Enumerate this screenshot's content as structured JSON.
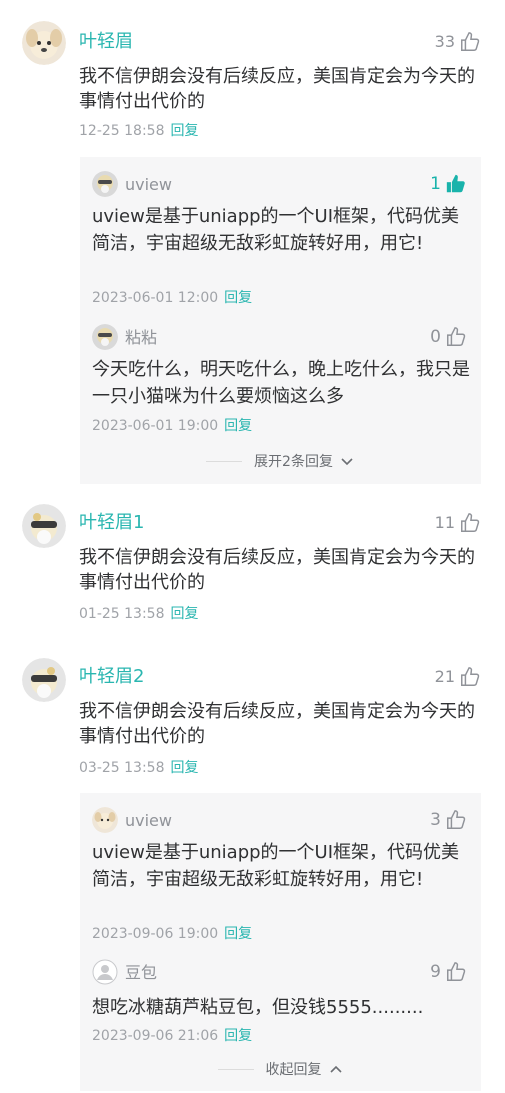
{
  "colors": {
    "accent": "#2ab6b0",
    "liked": "#19b3ab",
    "muted": "#a0a3a8",
    "reply_bg": "#f6f6f7"
  },
  "comments": [
    {
      "name": "叶轻眉",
      "likes": "33",
      "text": "我不信伊朗会没有后续反应，美国肯定会为今天的事情付出代价的",
      "date": "12-25 18:58",
      "reply_label": "回复",
      "replies": [
        {
          "name": "uview",
          "likes": "1",
          "liked": true,
          "text": "uview是基于uniapp的一个UI框架，代码优美简洁，宇宙超级无敌彩虹旋转好用，用它!",
          "date": "2023-06-01 12:00",
          "reply_label": "回复"
        },
        {
          "name": "粘粘",
          "likes": "0",
          "liked": false,
          "text": "今天吃什么，明天吃什么，晚上吃什么，我只是一只小猫咪为什么要烦恼这么多",
          "date": "2023-06-01 19:00",
          "reply_label": "回复"
        }
      ],
      "toggle_label": "展开2条回复"
    },
    {
      "name": "叶轻眉1",
      "likes": "11",
      "text": "我不信伊朗会没有后续反应，美国肯定会为今天的事情付出代价的",
      "date": "01-25 13:58",
      "reply_label": "回复"
    },
    {
      "name": "叶轻眉2",
      "likes": "21",
      "text": "我不信伊朗会没有后续反应，美国肯定会为今天的事情付出代价的",
      "date": "03-25 13:58",
      "reply_label": "回复",
      "replies": [
        {
          "name": "uview",
          "likes": "3",
          "liked": false,
          "text": "uview是基于uniapp的一个UI框架，代码优美简洁，宇宙超级无敌彩虹旋转好用，用它!",
          "date": "2023-09-06 19:00",
          "reply_label": "回复"
        },
        {
          "name": "豆包",
          "likes": "9",
          "liked": false,
          "text": "想吃冰糖葫芦粘豆包，但没钱5555.........",
          "date": "2023-09-06 21:06",
          "reply_label": "回复"
        }
      ],
      "toggle_label": "收起回复"
    }
  ]
}
